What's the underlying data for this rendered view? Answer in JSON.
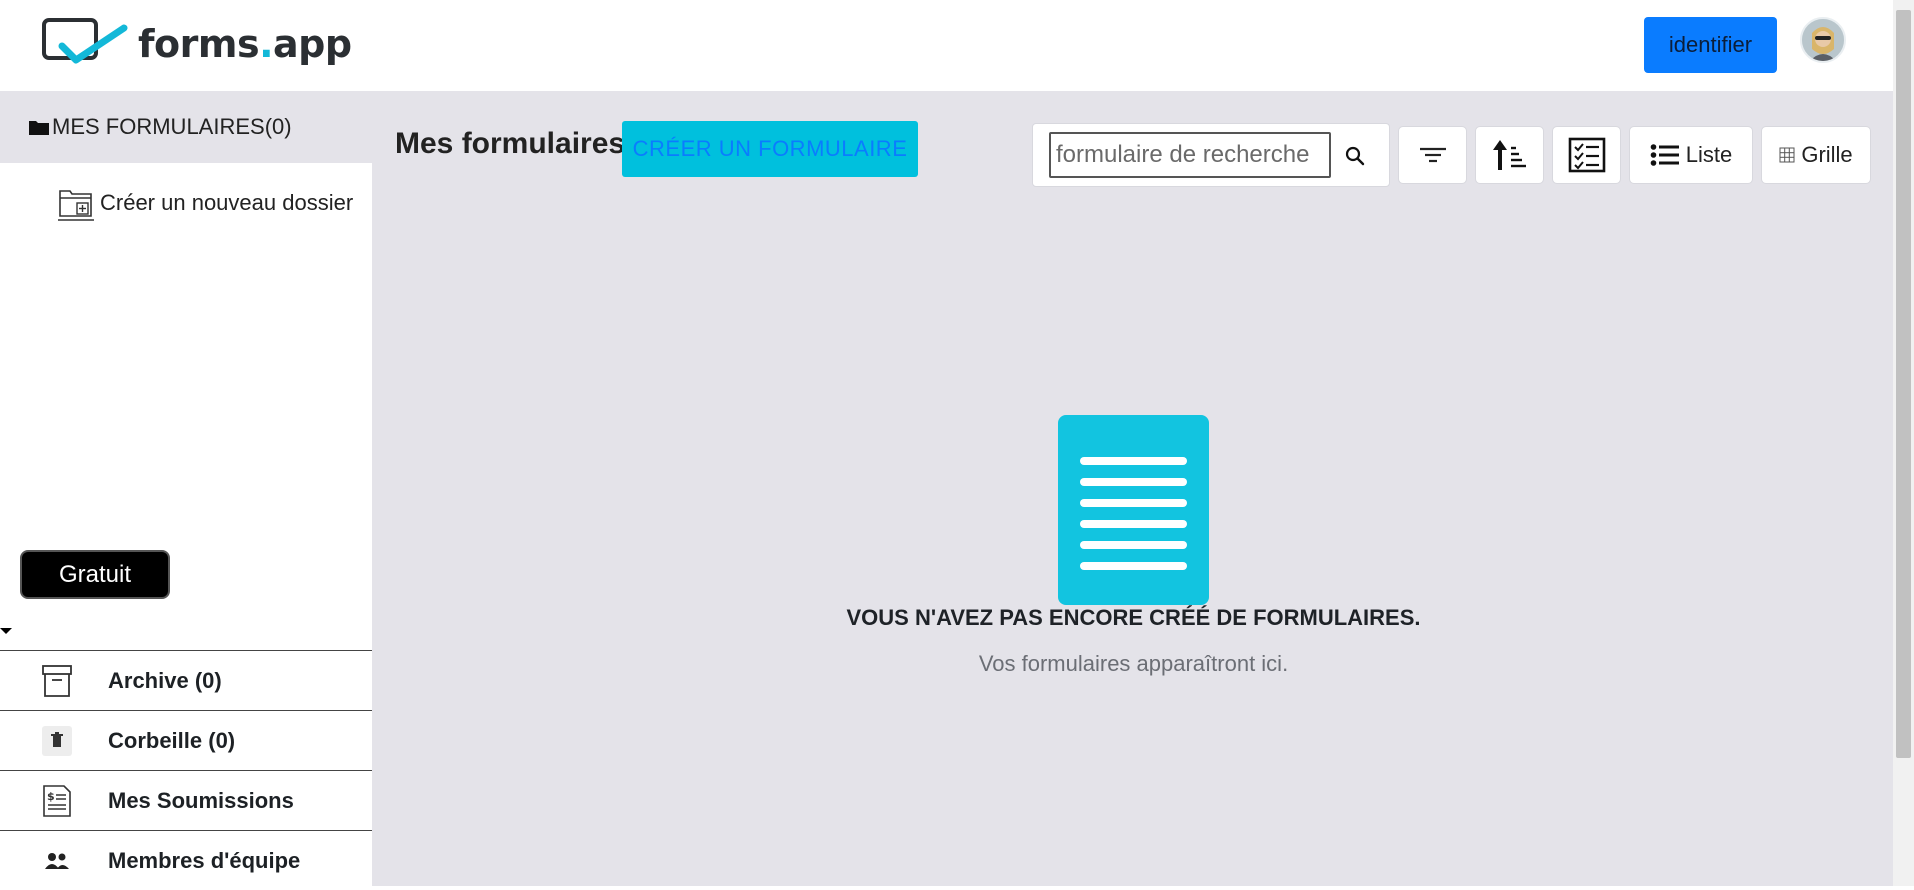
{
  "header": {
    "logo_text_main": "forms",
    "logo_text_dot": ".",
    "logo_text_tail": "app",
    "identify_label": "identifier"
  },
  "sidebar": {
    "top_label": "MES FORMULAIRES(0)",
    "new_folder_label": "Créer un nouveau dossier",
    "plan_badge": "Gratuit",
    "items": [
      {
        "label": "Archive (0)",
        "icon": "archive-icon"
      },
      {
        "label": "Corbeille (0)",
        "icon": "trash-icon"
      },
      {
        "label": "Mes Soumissions",
        "icon": "submissions-icon"
      },
      {
        "label": "Membres d'équipe",
        "icon": "team-icon"
      }
    ]
  },
  "main": {
    "title": "Mes formulaires",
    "create_label": "CRÉER UN FORMULAIRE",
    "search_placeholder": "formulaire de recherche",
    "view_list_label": "Liste",
    "view_grid_label": "Grille",
    "empty_title": "VOUS N'AVEZ PAS ENCORE CRÉÉ DE FORMULAIRES.",
    "empty_subtitle": "Vos formulaires apparaîtront ici."
  },
  "colors": {
    "accent_blue": "#0a7cff",
    "accent_cyan": "#00c0dd",
    "sidebar_bg": "#e4e3e9",
    "badge_bg": "#000000"
  }
}
